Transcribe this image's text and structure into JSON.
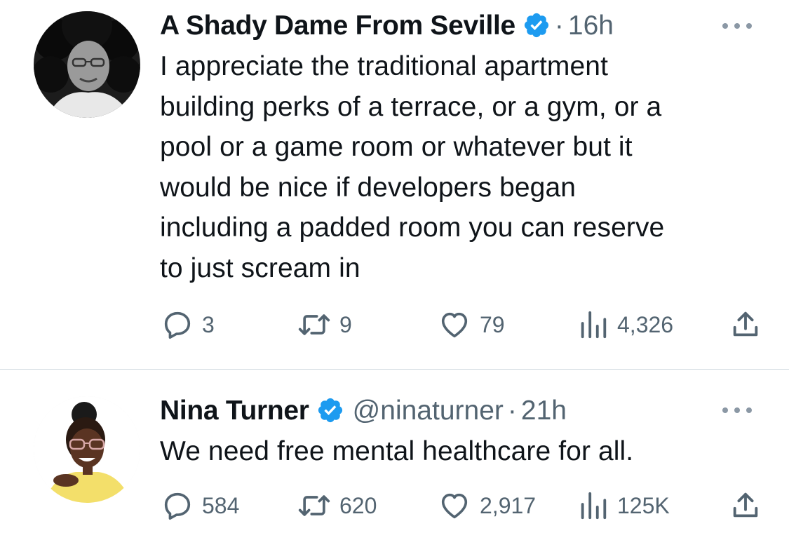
{
  "tweets": [
    {
      "author_name": "A Shady Dame From Seville",
      "verified": true,
      "handle": "",
      "separator": "·",
      "time": "16h",
      "text": "I appreciate the traditional apartment\nbuilding perks of a terrace, or a gym, or a\npool or a game room or whatever but it\nwould be nice if developers began\nincluding a padded room you can reserve\nto just scream in",
      "replies": "3",
      "retweets": "9",
      "likes": "79",
      "views": "4,326"
    },
    {
      "author_name": "Nina Turner",
      "verified": true,
      "handle": "@ninaturner",
      "separator": "·",
      "time": "21h",
      "text": "We need free mental healthcare for all.",
      "replies": "584",
      "retweets": "620",
      "likes": "2,917",
      "views": "125K"
    }
  ],
  "icons": {
    "reply": "reply-icon",
    "retweet": "retweet-icon",
    "like": "heart-icon",
    "views": "views-icon",
    "share": "share-icon",
    "more": "more-icon",
    "verified": "verified-badge-icon"
  },
  "colors": {
    "text": "#0f1419",
    "secondary": "#536471",
    "verified": "#1d9bf0",
    "divider": "#cfd9de"
  }
}
